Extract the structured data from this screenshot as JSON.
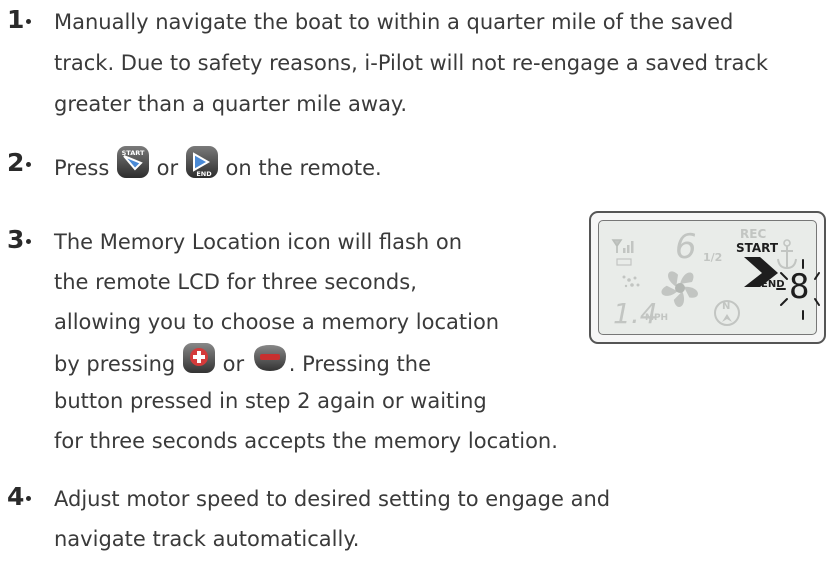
{
  "steps": [
    {
      "number": "1",
      "lines": [
        "Manually navigate the boat to within a quarter mile of the saved",
        "track. Due to safety reasons, i-Pilot will not re-engage a saved track",
        "greater than a quarter mile away."
      ]
    },
    {
      "number": "2",
      "text_before": "Press",
      "text_between": "or",
      "text_after": "on the remote.",
      "start_button_label": "START",
      "end_button_label": "END"
    },
    {
      "number": "3",
      "lines": [
        "The Memory Location icon will flash on",
        "the remote LCD for three seconds,",
        "allowing you to choose a memory location"
      ],
      "line4_before": "by pressing",
      "line4_between": "or",
      "line4_after": ".  Pressing the",
      "line5": "button pressed in step 2 again or waiting",
      "line6": "for three seconds accepts the memory location."
    },
    {
      "number": "4",
      "lines": [
        "Adjust motor speed to desired setting to engage and",
        "navigate track automatically."
      ]
    }
  ],
  "lcd": {
    "rec_label": "REC",
    "start_label": "START",
    "end_label": "END",
    "speed_ghost": "1.4",
    "speed_unit": "MPH",
    "gear_ghost": "6",
    "gear_fraction": "1/2",
    "compass_label": "N",
    "memory_digit": "8"
  },
  "colors": {
    "text": "#3a3a3a",
    "start_button": "#3a78c2",
    "plus_button": "#d43b3b",
    "minus_button": "#c8302f"
  }
}
